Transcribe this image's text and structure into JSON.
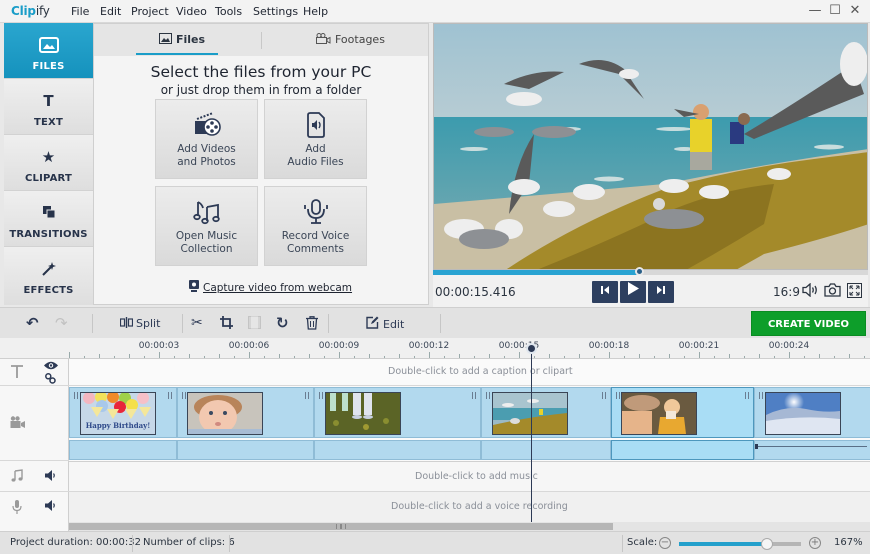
{
  "app": {
    "brand_a": "Clip",
    "brand_b": "ify"
  },
  "menu": [
    "File",
    "Edit",
    "Project",
    "Video",
    "Tools",
    "Settings",
    "Help"
  ],
  "window_controls": {
    "minimize": "—",
    "maximize": "☐",
    "close": "✕"
  },
  "sidebar": {
    "items": [
      {
        "label": "FILES",
        "icon": "image-icon",
        "glyph": "▣",
        "active": true
      },
      {
        "label": "TEXT",
        "icon": "text-icon",
        "glyph": "T",
        "active": false
      },
      {
        "label": "CLIPART",
        "icon": "star-icon",
        "glyph": "★",
        "active": false
      },
      {
        "label": "TRANSITIONS",
        "icon": "transitions-icon",
        "glyph": "⧉",
        "active": false
      },
      {
        "label": "EFFECTS",
        "icon": "magic-wand-icon",
        "glyph": "⚚",
        "active": false
      }
    ]
  },
  "files_panel": {
    "tabs": [
      {
        "label": "Files",
        "glyph": "🖾",
        "active": true
      },
      {
        "label": "Footages",
        "glyph": "🎥",
        "active": false
      }
    ],
    "heading": "Select the files from your PC",
    "subheading": "or just drop them in from a folder",
    "tiles": [
      {
        "line1": "Add Videos",
        "line2": "and Photos",
        "glyph": "🎬",
        "icon": "film-reel-icon"
      },
      {
        "line1": "Add",
        "line2": "Audio Files",
        "glyph": "🔊",
        "icon": "audio-file-icon"
      },
      {
        "line1": "Open Music",
        "line2": "Collection",
        "glyph": "♫",
        "icon": "music-notes-icon"
      },
      {
        "line1": "Record Voice",
        "line2": "Comments",
        "glyph": "🎙",
        "icon": "microphone-icon"
      }
    ],
    "webcam_link": "Capture video from webcam"
  },
  "player": {
    "timecode": "00:00:15.416",
    "progress": 0.475,
    "aspect_ratio": "16:9",
    "buttons": {
      "prev": "⏮",
      "play": "▶",
      "next": "⏭"
    },
    "icons": {
      "volume": "🔈",
      "snapshot": "📷",
      "fullscreen": "⛶"
    }
  },
  "toolbar": {
    "undo": "↶",
    "redo": "↷",
    "split_label": "Split",
    "edit_label": "Edit",
    "create_label": "CREATE VIDEO",
    "glyphs": {
      "split": "⊪",
      "cut": "✂",
      "crop": "⌗",
      "rotate": "↻",
      "delete": "🗑",
      "edit": "✎"
    }
  },
  "timeline": {
    "ruler_labels": [
      "00:00:03",
      "00:00:06",
      "00:00:09",
      "00:00:12",
      "00:00:15",
      "00:00:18",
      "00:00:21",
      "00:00:24"
    ],
    "playhead_time": "00:00:15.416",
    "caption_hint": "Double-click to add a caption or clipart",
    "music_hint": "Double-click to add music",
    "voice_hint": "Double-click to add a voice recording",
    "thumb_caption": "Happy Birthday!",
    "clips": [
      {
        "name": "happy-birthday",
        "selected": false
      },
      {
        "name": "baby-face",
        "selected": false
      },
      {
        "name": "feet-on-grass",
        "selected": false
      },
      {
        "name": "seagulls-beach",
        "selected": false
      },
      {
        "name": "child-eating",
        "selected": true
      },
      {
        "name": "snowy-field",
        "selected": false
      }
    ]
  },
  "status": {
    "duration_label": "Project duration:",
    "duration_value": "00:00:32",
    "clips_label": "Number of clips:",
    "clips_value": "6",
    "scale_label": "Scale:",
    "scale_value": "167%",
    "scale_fraction": 0.72
  },
  "colors": {
    "accent": "#1a9dc8",
    "create": "#0d9e2a",
    "navy": "#2d3f5f"
  }
}
